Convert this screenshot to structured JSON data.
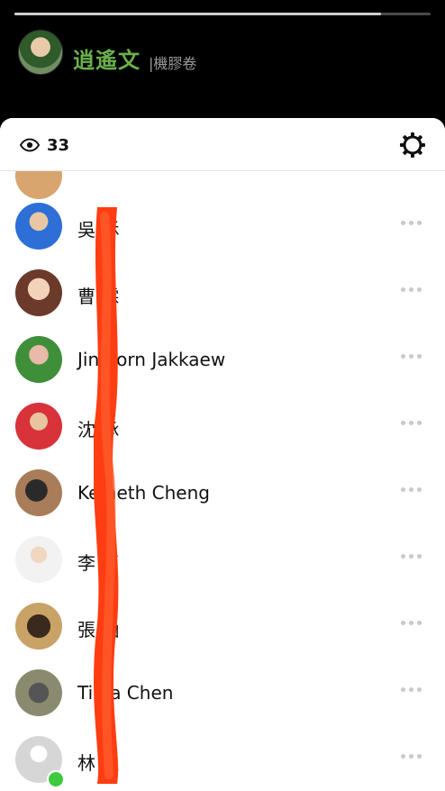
{
  "story": {
    "progress": 0.88
  },
  "host": {
    "name": "逍遙文",
    "subtitle": "|機膠卷"
  },
  "viewers_panel": {
    "view_count": "33",
    "viewers": [
      {
        "name": "吳 秝"
      },
      {
        "name": "曹 霖"
      },
      {
        "name": "Jin porn Jakkaew"
      },
      {
        "name": "沈 承"
      },
      {
        "name": "Ke neth Cheng"
      },
      {
        "name": "李 貞"
      },
      {
        "name": "張 涵"
      },
      {
        "name": "Tin a Chen"
      },
      {
        "name": "林 里",
        "online": true
      }
    ]
  },
  "colors": {
    "host_name": "#6ab04c",
    "online": "#3ec93e",
    "scribble": "#ff3d12"
  },
  "icons": [
    "eye-icon",
    "gear-icon",
    "more-horizontal-icon"
  ]
}
